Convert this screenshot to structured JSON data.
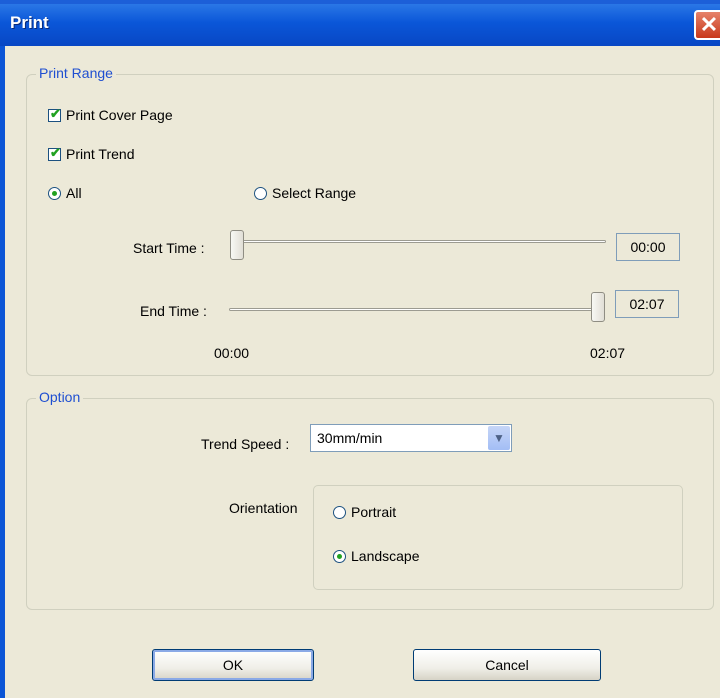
{
  "window": {
    "title": "Print",
    "close_glyph": "✕"
  },
  "print_range": {
    "legend": "Print Range",
    "print_cover_page": {
      "label": "Print Cover Page",
      "checked": true
    },
    "print_trend": {
      "label": "Print Trend",
      "checked": true
    },
    "radio_all": {
      "label": "All",
      "selected": true
    },
    "radio_select_range": {
      "label": "Select Range",
      "selected": false
    },
    "start_time": {
      "label": "Start Time :",
      "value": "00:00",
      "slider_fraction": 0.0
    },
    "end_time": {
      "label": "End Time :",
      "value": "02:07",
      "slider_fraction": 1.0
    },
    "scale_min": "00:00",
    "scale_max": "02:07"
  },
  "option": {
    "legend": "Option",
    "trend_speed": {
      "label": "Trend Speed :",
      "value": "30mm/min",
      "arrow_glyph": "▼"
    },
    "orientation": {
      "label": "Orientation",
      "portrait": {
        "label": "Portrait",
        "selected": false
      },
      "landscape": {
        "label": "Landscape",
        "selected": true
      }
    }
  },
  "buttons": {
    "ok": "OK",
    "cancel": "Cancel"
  },
  "icons": {
    "checkbox_checked": "check-icon",
    "radio_selected": "radio-dot-icon",
    "dropdown": "chevron-down-icon",
    "close": "close-icon"
  },
  "colors": {
    "title_bar": "#0a56d8",
    "group_legend": "#1f4fd1",
    "dialog_bg": "#ece9d8",
    "check_mark": "#21a121",
    "close_button": "#c8381a"
  }
}
